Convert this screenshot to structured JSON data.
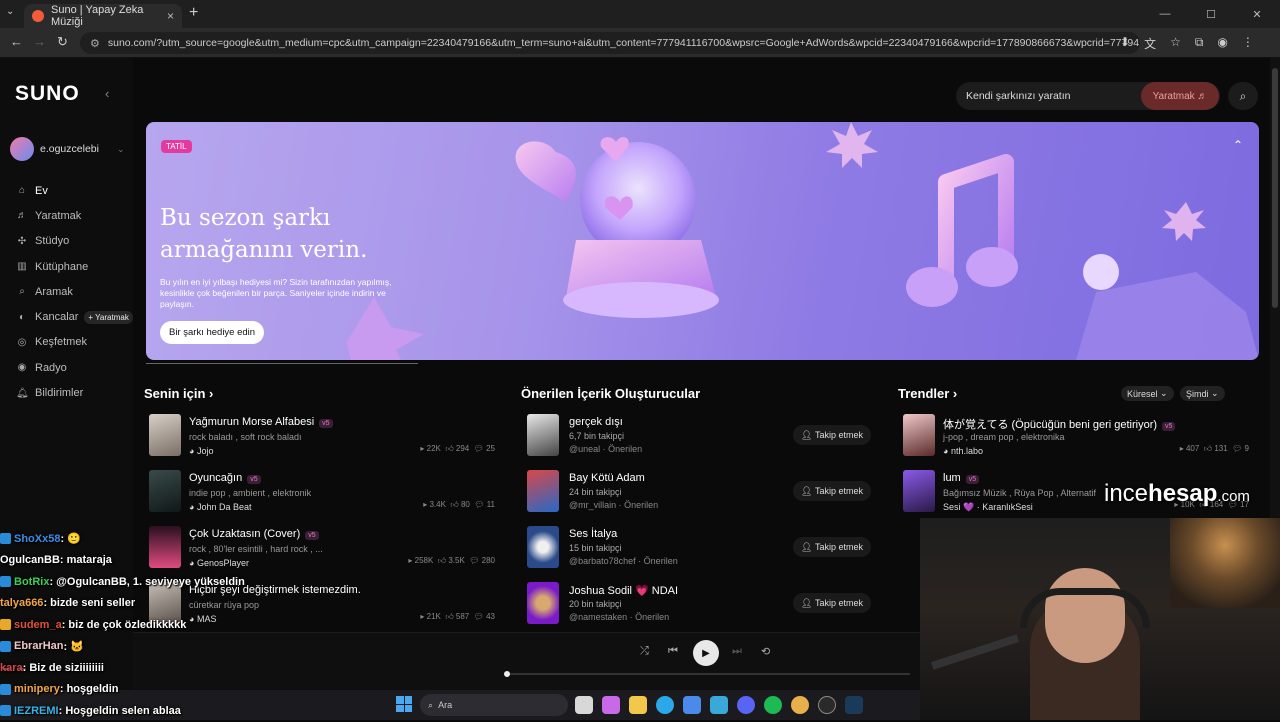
{
  "browser": {
    "tab_title": "Suno | Yapay Zeka Müziği",
    "url": "suno.com/?utm_source=google&utm_medium=cpc&utm_campaign=22340479166&utm_term=suno+ai&utm_content=777941116700&wpsrc=Google+AdWords&wpcid=22340479166&wpcrid=177890866673&wpcrid=777941116700&wpkwi..."
  },
  "sidebar": {
    "logo": "SUNO",
    "username": "e.oguzcelebi",
    "items": [
      {
        "label": "Ev",
        "icon": "home-icon"
      },
      {
        "label": "Yaratmak",
        "icon": "music-note-icon"
      },
      {
        "label": "Stüdyo",
        "icon": "studio-icon"
      },
      {
        "label": "Kütüphane",
        "icon": "library-icon"
      },
      {
        "label": "Aramak",
        "icon": "search-icon"
      },
      {
        "label": "Kancalar",
        "icon": "hooks-icon",
        "pill": "+ Yaratmak"
      },
      {
        "label": "Keşfetmek",
        "icon": "explore-icon"
      },
      {
        "label": "Radyo",
        "icon": "radio-icon"
      },
      {
        "label": "Bildirimler",
        "icon": "bell-icon"
      }
    ]
  },
  "header": {
    "search_placeholder": "Kendi şarkınızı yaratın",
    "create_label": "Yaratmak"
  },
  "banner": {
    "badge": "TATİL",
    "headline": "Bu sezon şarkı armağanını verin.",
    "subtext": "Bu yılın en iyi yılbaşı hediyesi mi? Sizin tarafınızdan yapılmış, kesinlikle çok beğenilen bir parça. Saniyeler içinde indirin ve paylaşın.",
    "button": "Bir şarkı hediye edin"
  },
  "for_you": {
    "title": "Senin için",
    "songs": [
      {
        "title": "Yağmurun Morse Alfabesi",
        "version": "v5",
        "genres": "rock baladı , soft rock baladı",
        "artist": "Jojo",
        "plays": "22K",
        "likes": "294",
        "comments": "25"
      },
      {
        "title": "Oyuncağın",
        "version": "v5",
        "genres": "indie pop , ambient , elektronik",
        "artist": "John Da Beat",
        "plays": "3.4K",
        "likes": "80",
        "comments": "11"
      },
      {
        "title": "Çok Uzaktasın (Cover)",
        "version": "v5",
        "genres": "rock , 80'ler esintili , hard rock , ...",
        "artist": "GenosPlayer",
        "plays": "258K",
        "likes": "3.5K",
        "comments": "280"
      },
      {
        "title": "Hiçbir şeyi değiştirmek istemezdim.",
        "version": "",
        "genres": "cüretkar rüya pop",
        "artist": "MAS",
        "plays": "21K",
        "likes": "587",
        "comments": "43"
      }
    ]
  },
  "creators": {
    "title": "Önerilen İçerik Oluşturucular",
    "follow_label": "Takip etmek",
    "items": [
      {
        "name": "gerçek dışı",
        "followers": "6,7 bin takipçi",
        "handle": "@uneal · Önerilen"
      },
      {
        "name": "Bay Kötü Adam",
        "followers": "24 bin takipçi",
        "handle": "@mr_villain · Önerilen"
      },
      {
        "name": "Ses İtalya",
        "followers": "15 bin takipçi",
        "handle": "@barbato78chef · Önerilen"
      },
      {
        "name": "Joshua Sodil 💗 NDAI",
        "followers": "20 bin takipçi",
        "handle": "@namestaken · Önerilen"
      }
    ]
  },
  "trends": {
    "title": "Trendler",
    "filter_region": "Küresel",
    "filter_time": "Şimdi",
    "songs": [
      {
        "title": "体が覚えてる (Öpücüğün beni geri getiriyor)",
        "version": "v5",
        "genres": "j-pop , dream pop , elektronika",
        "artist": "nth.labo",
        "plays": "407",
        "likes": "131",
        "comments": "9"
      },
      {
        "title": "lum",
        "version": "v5",
        "genres": "Bağımsız Müzik , Rüya Pop , Alternatif",
        "artist": "Sesi 💜 · KaranlıkSesi",
        "plays": "10K",
        "likes": "164",
        "comments": "17"
      }
    ]
  },
  "taskbar": {
    "search": "Ara"
  },
  "stream": {
    "watermark_a": "ince",
    "watermark_b": "hesap",
    "watermark_c": ".com",
    "chat": [
      {
        "user": "ShoXx58",
        "text": " : 🙂",
        "color": "#3a8ee8"
      },
      {
        "user": "OgulcanBB",
        "text": " : mataraja",
        "color": "#ffffff"
      },
      {
        "user": "BotRix",
        "text": " : @OgulcanBB, 1. seviyeye yükseldin",
        "color": "#39d353"
      },
      {
        "user": "talya666",
        "text": " : bizde seni seller",
        "color": "#f2a64a"
      },
      {
        "user": "sudem_a",
        "text": " : biz de çok özledikkkkk",
        "color": "#e0523a"
      },
      {
        "user": "EbrarHan",
        "text": " : 🐱",
        "color": "#f0c8c8"
      },
      {
        "user": "k̶ara̶ ",
        "text": " : Biz de siziiiiiiii",
        "color": "#d04a4a"
      },
      {
        "user": "minipery",
        "text": " : hoşgeldin",
        "color": "#f2a64a"
      },
      {
        "user": "IEZREMI",
        "text": " : Hoşgeldin selen ablaa",
        "color": "#39b4e8"
      }
    ]
  }
}
